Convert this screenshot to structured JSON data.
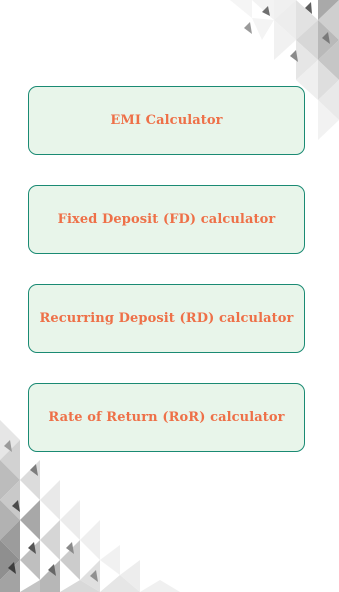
{
  "calculators": {
    "items": [
      {
        "label": "EMI Calculator"
      },
      {
        "label": "Fixed Deposit (FD) calculator"
      },
      {
        "label": "Recurring Deposit (RD) calculator"
      },
      {
        "label": "Rate of Return (RoR) calculator"
      }
    ]
  },
  "colors": {
    "card_border": "#1a8a73",
    "card_fill": "#e8f5ea",
    "label_text": "#ee7048"
  }
}
